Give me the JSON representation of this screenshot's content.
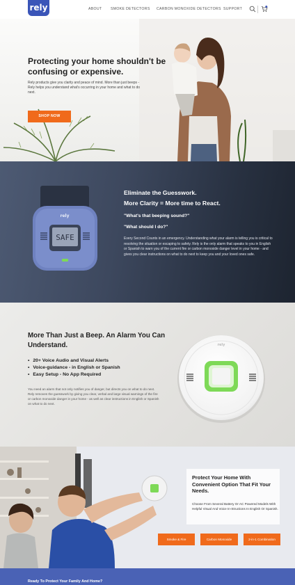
{
  "header": {
    "logo": "rely",
    "nav": [
      "ABOUT",
      "SMOKE DETECTORS",
      "CARBON MONOXIDE DETECTORS",
      "SUPPORT"
    ],
    "icons": [
      "search-icon",
      "cart-icon"
    ],
    "cart_badge_color": "#3a55b8"
  },
  "hero": {
    "title": "Protecting your home shouldn't be confusing or expensive.",
    "text": "Rely products give you clarity and peace of mind. More than just beeps - Rely helps you understand what's occurring in your home and what to do next.",
    "button": "SHOP NOW"
  },
  "guesswork": {
    "heading1": "Eliminate the Guesswork.",
    "heading2": "More Clarity = More time to React.",
    "q1": "\"What's that beeping sound?\"",
    "q2": "\"What should I do?\"",
    "text": "Every Second Counts in an emergency. Understanding what your alarm is telling you is critical to resolving the situation or escaping to safety. Rely is the only alarm that speaks to you in English or Spanish to warn you of the current fire or carbon monoxide danger level in your home - and gives you clear instructions on what to do next to keep you and your loved ones safe.",
    "device_brand": "rely",
    "device_display": "SAFE"
  },
  "beep": {
    "heading": "More Than Just a Beep. An Alarm You Can Understand.",
    "bullets": [
      "20+ Voice Audio and Visual Alerts",
      "Voice-guidance - in English or Spanish",
      "Easy Setup - No App Required"
    ],
    "text": "You need an alarm that not only notifies you of danger, but directs you on what to do next. Rely removes the guesswork by giving you clear, verbal and large visual warnings of the fire or carbon monoxide danger in your home - as well as clear instructions in English or Spanish on what to do next.",
    "device_brand": "rely"
  },
  "protect": {
    "heading": "Protect Your Home With Convenient Option That Fit Your Needs.",
    "text": "Choose From Several Battery Or AC Powered Models With Helpful Visual And Voice In-Structions In English Or Spanish.",
    "buttons": [
      "Smoke & Fire",
      "Carbon Monoxide",
      "2-in-1 Combination"
    ]
  },
  "bottom": {
    "text": "Ready To Protect Your Family And Home?"
  },
  "colors": {
    "accent": "#f06a1b",
    "brand": "#3a55b8",
    "dark_section": "#2f384a",
    "detector_green": "#7ed957"
  }
}
